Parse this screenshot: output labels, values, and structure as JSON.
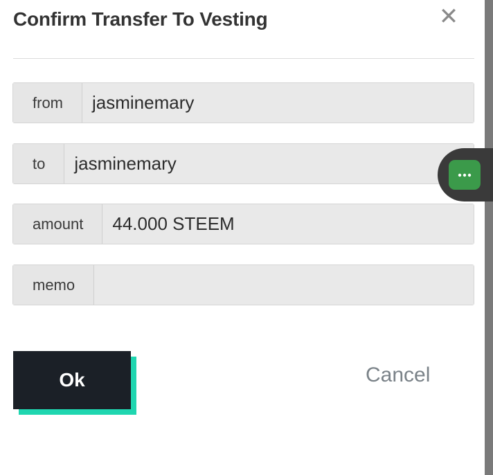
{
  "modal": {
    "title": "Confirm Transfer To Vesting",
    "close_glyph": "✕"
  },
  "fields": [
    {
      "label": "from",
      "value": "jasminemary"
    },
    {
      "label": "to",
      "value": "jasminemary"
    },
    {
      "label": "amount",
      "value": "44.000 STEEM"
    },
    {
      "label": "memo",
      "value": ""
    }
  ],
  "actions": {
    "ok_label": "Ok",
    "cancel_label": "Cancel"
  },
  "floating": {
    "icon": "more-dots-icon",
    "accent": "#3b9a4a"
  },
  "colors": {
    "ok_background": "#1b2027",
    "ok_shadow": "#1fd6b0"
  }
}
